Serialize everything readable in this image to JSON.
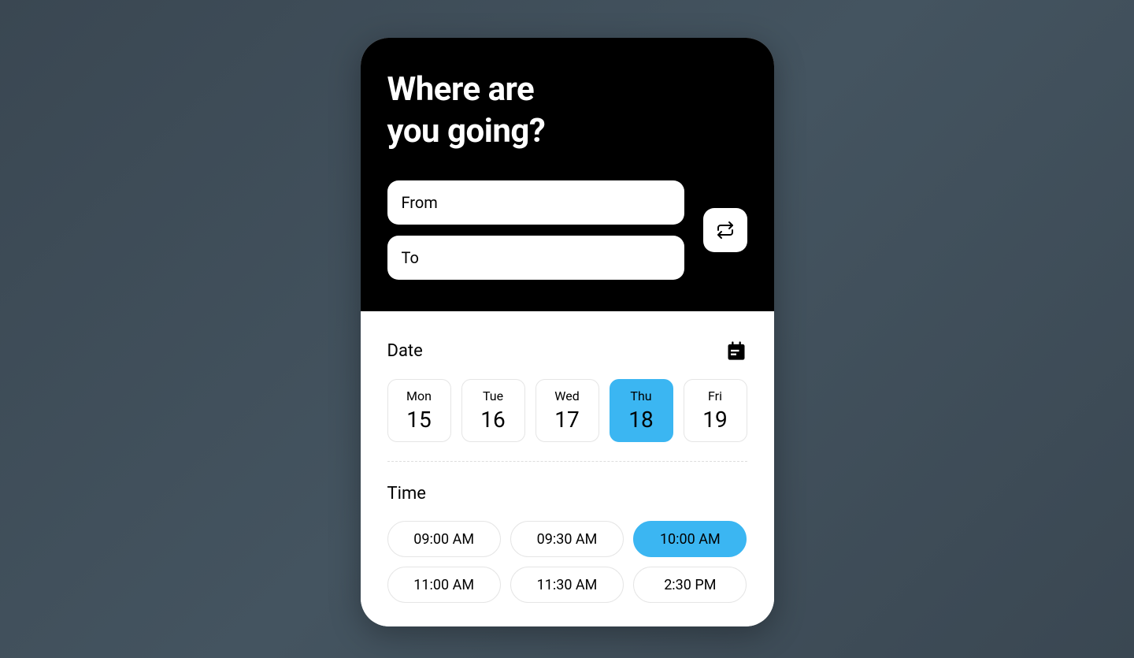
{
  "header": {
    "title_line1": "Where are",
    "title_line2": "you going?"
  },
  "inputs": {
    "from_placeholder": "From",
    "to_placeholder": "To"
  },
  "date_section": {
    "label": "Date",
    "items": [
      {
        "dow": "Mon",
        "num": "15",
        "selected": false
      },
      {
        "dow": "Tue",
        "num": "16",
        "selected": false
      },
      {
        "dow": "Wed",
        "num": "17",
        "selected": false
      },
      {
        "dow": "Thu",
        "num": "18",
        "selected": true
      },
      {
        "dow": "Fri",
        "num": "19",
        "selected": false
      }
    ]
  },
  "time_section": {
    "label": "Time",
    "items": [
      {
        "label": "09:00 AM",
        "selected": false
      },
      {
        "label": "09:30 AM",
        "selected": false
      },
      {
        "label": "10:00 AM",
        "selected": true
      },
      {
        "label": "11:00 AM",
        "selected": false
      },
      {
        "label": "11:30 AM",
        "selected": false
      },
      {
        "label": "2:30 PM",
        "selected": false
      }
    ]
  },
  "colors": {
    "accent": "#3BB6F2"
  },
  "icons": {
    "swap": "swap-icon",
    "calendar": "calendar-icon"
  }
}
